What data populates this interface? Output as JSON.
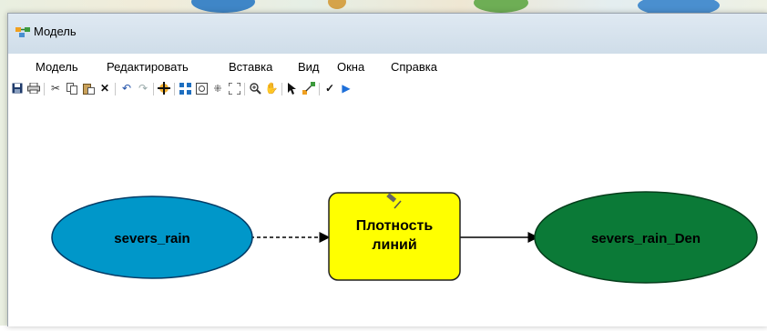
{
  "window": {
    "title": "Модель",
    "app_icon": "model-builder-icon"
  },
  "menu": [
    "Модель",
    "Редактировать",
    "Вставка",
    "Вид",
    "Окна",
    "Справка"
  ],
  "toolbar": {
    "icons": [
      "save-icon",
      "print-icon",
      "cut-icon",
      "copy-icon",
      "paste-icon",
      "delete-icon",
      "undo-icon",
      "redo-icon",
      "add-data-icon",
      "auto-layout-icon",
      "full-extent-icon",
      "fixed-zoom-in-icon",
      "fixed-zoom-out-icon",
      "zoom-in-icon",
      "pan-icon",
      "select-icon",
      "connect-icon",
      "validate-icon",
      "run-icon"
    ]
  },
  "diagram": {
    "input_node": {
      "label": "severs_rain",
      "color": "#0097c9"
    },
    "tool_node": {
      "label_line1": "Плотность",
      "label_line2": "линий",
      "color": "#ffff00",
      "icon": "hammer-icon"
    },
    "output_node": {
      "label": "severs_rain_Den",
      "color": "#0b7a37"
    }
  }
}
